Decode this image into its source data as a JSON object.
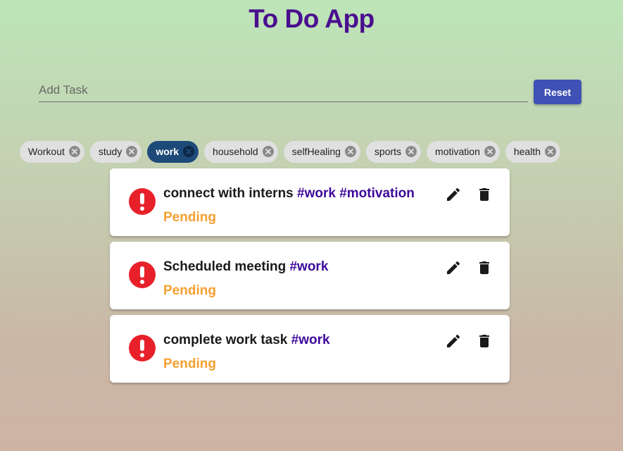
{
  "app": {
    "title": "To Do App"
  },
  "add_task": {
    "placeholder": "Add Task",
    "value": "",
    "reset_label": "Reset"
  },
  "tags": [
    {
      "label": "Workout",
      "selected": false
    },
    {
      "label": "study",
      "selected": false
    },
    {
      "label": "work",
      "selected": true
    },
    {
      "label": "household",
      "selected": false
    },
    {
      "label": "selfHealing",
      "selected": false
    },
    {
      "label": "sports",
      "selected": false
    },
    {
      "label": "motivation",
      "selected": false
    },
    {
      "label": "health",
      "selected": false
    }
  ],
  "tasks": [
    {
      "text": "connect with interns",
      "tags": "#work #motivation",
      "status": "Pending",
      "icon": "alert-icon"
    },
    {
      "text": "Scheduled meeting",
      "tags": "#work",
      "status": "Pending",
      "icon": "alert-icon"
    },
    {
      "text": "complete work task",
      "tags": "#work",
      "status": "Pending",
      "icon": "alert-icon"
    }
  ],
  "colors": {
    "title": "#4a0e8f",
    "accent": "#3f51b5",
    "selected_chip": "#1e4a7a",
    "tag_text": "#3d0a9a",
    "pending": "#f5a030",
    "alert": "#e8202a"
  },
  "icons": {
    "edit": "pencil-icon",
    "delete": "trash-icon",
    "chip_remove": "close-circle-icon"
  }
}
